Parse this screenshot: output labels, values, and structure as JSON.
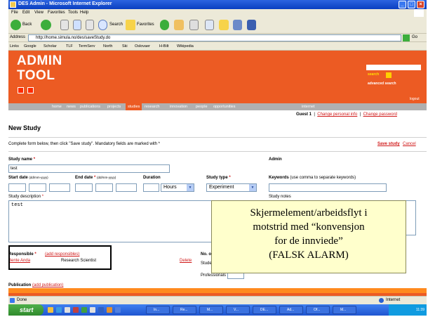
{
  "window": {
    "title": "DES Admin - Microsoft Internet Explorer"
  },
  "menu": [
    "File",
    "Edit",
    "View",
    "Favorites",
    "Tools",
    "Help"
  ],
  "toolbar": {
    "back_label": "Back",
    "search_label": "Search",
    "favorites_label": "Favorites"
  },
  "address": {
    "label": "Address",
    "url": "http://home.simula.no/des/saveStudy.do",
    "go_label": "Go"
  },
  "links": {
    "label": "Links",
    "items": [
      "Google",
      "Scholar",
      "TLF",
      "TermServ",
      "North",
      "Ski",
      "Oslovaer",
      "H-Bilt",
      "Wikipedia"
    ]
  },
  "header": {
    "logo_line1": "ADMIN",
    "logo_line2": "TOOL",
    "search_button": "search",
    "advanced_search": "advanced search",
    "logout": "logout"
  },
  "nav": {
    "items": [
      "home",
      "news",
      "publications",
      "projects",
      "studies",
      "research",
      "innovation",
      "people",
      "opportunities"
    ],
    "active": "studies",
    "internet": "internet"
  },
  "user": {
    "guest": "Guest 1",
    "change_personal": "Change personal info",
    "change_password": "Change password"
  },
  "form": {
    "page_title": "New Study",
    "instructions": "Complete form below, then click \"Save study\". Mandatory fields are marked with *",
    "save_link": "Save study",
    "cancel_link": "Cancel",
    "study_name_label": "Study name",
    "study_name_value": "test",
    "admin_label": "Admin",
    "start_date_label": "Start date",
    "start_date_hint": "(dd/mm-yyyy)",
    "end_date_label": "End date",
    "end_date_hint": "(dd/mm-yyyy)",
    "duration_label": "Duration",
    "duration_unit": "Hours",
    "study_type_label": "Study type",
    "study_type_value": "Experiment",
    "keywords_label": "Keywords",
    "keywords_hint": "(use comma to separate keywords)",
    "study_notes_label": "Study notes",
    "description_label": "Study description",
    "description_value": "test",
    "responsible_label": "Responsible",
    "add_responsibles": "add responsibles",
    "responsible_name": "Bente Anda",
    "responsible_role": "Research Scientist",
    "delete_link": "Delete",
    "participants_label": "No. of partici",
    "students_label": "Students",
    "professionals_label": "Professionals",
    "publication_label": "Publication",
    "add_publication": "add publication"
  },
  "callout": {
    "line1": "Skjermelement/arbeidsflyt i",
    "line2": "motstrid med “konvensjon",
    "line3": "for de innviede”",
    "line4": "(FALSK ALARM)"
  },
  "status": {
    "left": "Done",
    "zone": "Internet"
  },
  "taskbar": {
    "start": "start",
    "clock": "11:39",
    "tasks": [
      "In...",
      "Re...",
      "M...",
      "V...",
      "DE...",
      "Ad...",
      "Of...",
      "M..."
    ]
  },
  "colors": {
    "accent_orange": "#ec5b23",
    "link_red": "#d01818",
    "xp_blue": "#0a3fc0"
  }
}
